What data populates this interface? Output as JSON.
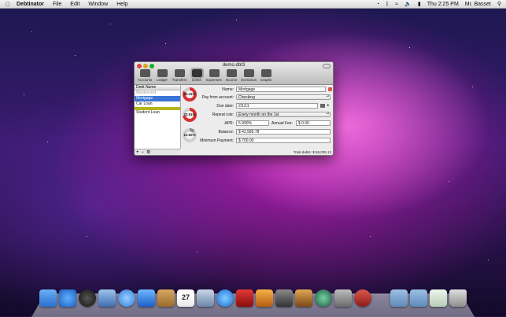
{
  "menubar": {
    "app_name": "Debtinator",
    "menus": [
      "File",
      "Edit",
      "Window",
      "Help"
    ],
    "clock": "Thu 2:25 PM",
    "user": "Mr. Basset"
  },
  "window": {
    "title": "demo.dbt3",
    "toolbar": [
      "Accounts",
      "Ledger",
      "Transfers",
      "Debts",
      "Expenses",
      "Income",
      "Scenarios",
      "Graphs"
    ],
    "sidebar": {
      "header": "Debt Name",
      "items": [
        "Mastercard",
        "Mortgage",
        "Car Loan",
        "",
        "Student Loan"
      ]
    },
    "pies": [
      "83.41%",
      "72.91%",
      "12.92%"
    ],
    "form": {
      "name_label": "Name:",
      "name_value": "Mortgage",
      "pay_label": "Pay from account:",
      "pay_value": "Checking",
      "due_label": "Due date:",
      "due_value": "2/1/11",
      "repeat_label": "Repeat rule:",
      "repeat_value": "Every month on the 1st",
      "apr_label": "APR:",
      "apr_value": "5.990%",
      "fee_label": "Annual Fee:",
      "fee_value": "$ 0.00",
      "balance_label": "Balance:",
      "balance_value": "$ 42,585.78",
      "minpay_label": "Minimum Payment:",
      "minpay_value": "$ 700.00"
    },
    "total": "Total debts: $ 58,005.13"
  },
  "dock_icons": [
    "finder",
    "appstore",
    "dashboard",
    "mail",
    "safari",
    "facetime",
    "addressbook",
    "ical",
    "preview",
    "itunes",
    "photobooth",
    "iphoto",
    "imovie",
    "garageband",
    "timemachine",
    "systemprefs",
    "applications",
    "documents",
    "downloads",
    "trash"
  ]
}
